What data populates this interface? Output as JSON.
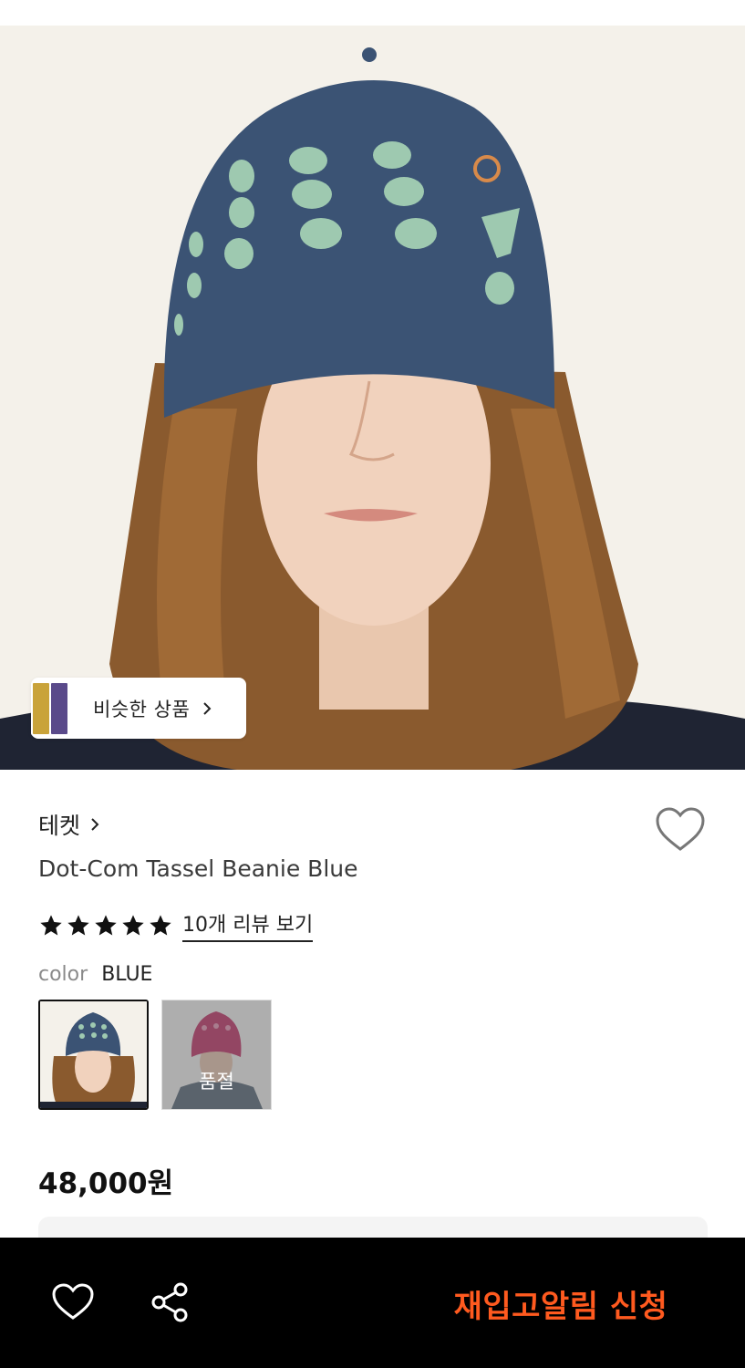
{
  "product": {
    "brand": "테켓",
    "title": "Dot-Com Tassel Beanie Blue",
    "rating_stars": 5,
    "review_link": "10개 리뷰 보기",
    "color_key": "color",
    "color_value": "BLUE",
    "price": "48,000원"
  },
  "similar_chip": {
    "label": "비슷한 상품"
  },
  "swatches": [
    {
      "color": "BLUE",
      "selected": true,
      "sold_out": false,
      "label": ""
    },
    {
      "color": "PINK",
      "selected": false,
      "sold_out": true,
      "label": "품절"
    }
  ],
  "bottom_bar": {
    "restock_label": "재입고알림 신청"
  },
  "colors": {
    "accent_orange": "#ff5a1f",
    "bottom_bar_bg": "#000000",
    "beanie_blue": "#3b5374",
    "dot_mint": "#9ec9b0"
  },
  "icons": {
    "wishlist": "heart-icon",
    "share": "share-icon",
    "arrow": "chevron-right-icon",
    "star": "star-icon"
  }
}
